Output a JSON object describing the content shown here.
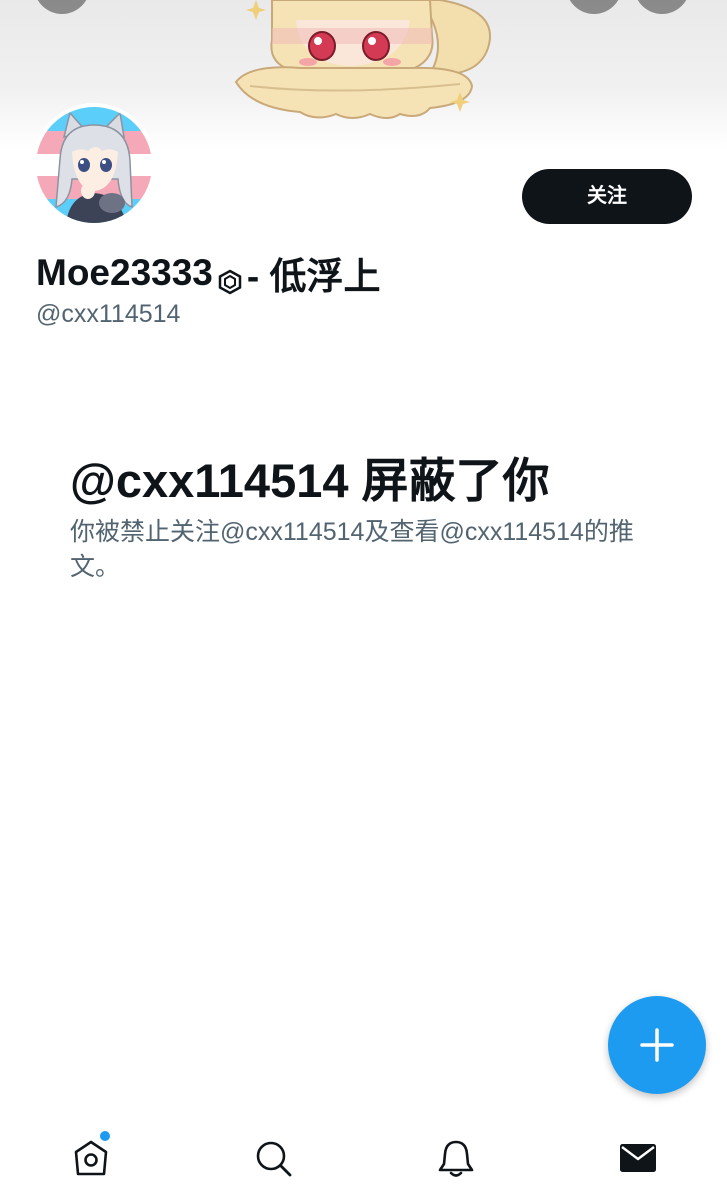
{
  "profile": {
    "display_name": "Moe23333",
    "display_name_suffix": " - 低浮上",
    "handle": "@cxx114514",
    "follow_label": "关注"
  },
  "blocked": {
    "title": "@cxx114514 屏蔽了你",
    "description": "你被禁止关注@cxx114514及查看@cxx114514的推文。"
  },
  "icons": {
    "badge": "hexagon-badge-icon",
    "compose": "plus-icon",
    "nav": [
      "home-icon",
      "search-icon",
      "bell-icon",
      "mail-icon"
    ]
  },
  "colors": {
    "accent": "#1d9bf0",
    "text_primary": "#0f1419",
    "text_secondary": "#536471",
    "button_dark": "#0f1419"
  }
}
